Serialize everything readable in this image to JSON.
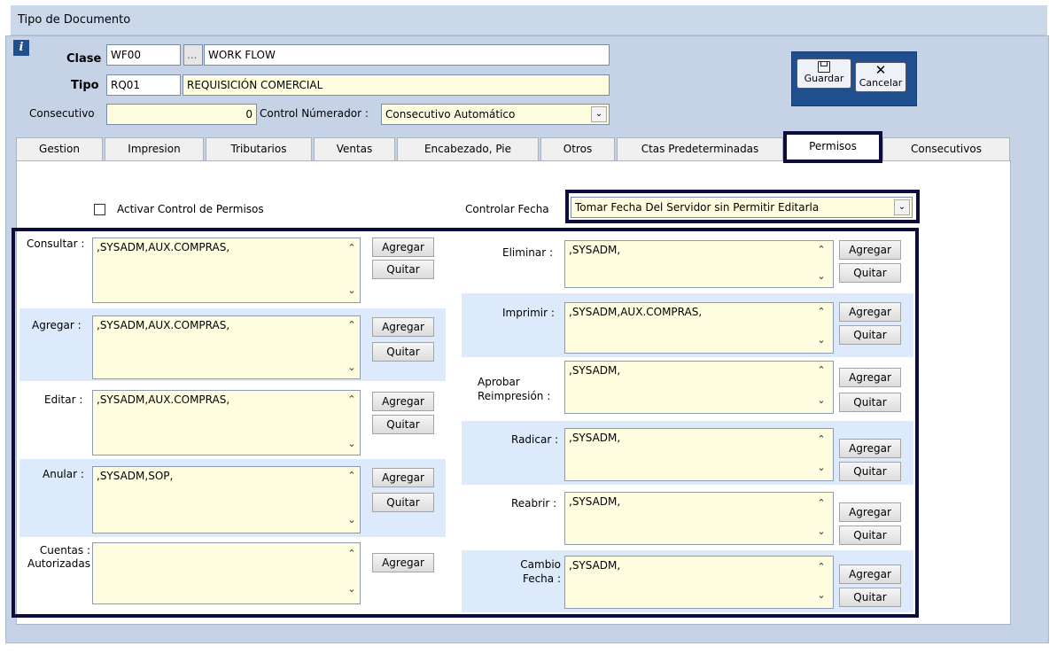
{
  "window": {
    "title": "Tipo de Documento"
  },
  "header": {
    "clase_label": "Clase",
    "clase_code": "WF00",
    "clase_dots": "...",
    "clase_name": "WORK FLOW",
    "tipo_label": "Tipo",
    "tipo_code": "RQ01",
    "tipo_name": "REQUISICIÓN COMERCIAL",
    "consecutivo_label": "Consecutivo",
    "consecutivo_value": "0",
    "control_label": "Control Númerador :",
    "control_value": "Consecutivo Automático"
  },
  "toolbar": {
    "save_label": "Guardar",
    "cancel_label": "Cancelar"
  },
  "tabs": [
    {
      "label": "Gestion"
    },
    {
      "label": "Impresion"
    },
    {
      "label": "Tributarios"
    },
    {
      "label": "Ventas"
    },
    {
      "label": "Encabezado, Pie"
    },
    {
      "label": "Otros"
    },
    {
      "label": "Ctas Predeterminadas"
    },
    {
      "label": "Permisos"
    },
    {
      "label": "Consecutivos"
    }
  ],
  "permisos": {
    "activar_label": "Activar Control de Permisos",
    "fecha_label": "Controlar Fecha",
    "fecha_value": "Tomar Fecha Del Servidor sin Permitir Editarla",
    "agregar": "Agregar",
    "quitar": "Quitar",
    "left": [
      {
        "label": "Consultar :",
        "value": ",SYSADM,AUX.COMPRAS,"
      },
      {
        "label": "Agregar :",
        "value": ",SYSADM,AUX.COMPRAS,"
      },
      {
        "label": "Editar :",
        "value": ",SYSADM,AUX.COMPRAS,"
      },
      {
        "label": "Anular :",
        "value": ",SYSADM,SOP,"
      },
      {
        "label": "Cuentas : Autorizadas",
        "value": ""
      }
    ],
    "right": [
      {
        "label": "Eliminar :",
        "value": ",SYSADM,"
      },
      {
        "label": "Imprimir :",
        "value": ",SYSADM,AUX.COMPRAS,"
      },
      {
        "label": "Aprobar Reimpresión :",
        "value": ",SYSADM,"
      },
      {
        "label": "Radicar :",
        "value": ",SYSADM,"
      },
      {
        "label": "Reabrir :",
        "value": ",SYSADM,"
      },
      {
        "label": "Cambio Fecha :",
        "value": ",SYSADM,"
      }
    ]
  }
}
